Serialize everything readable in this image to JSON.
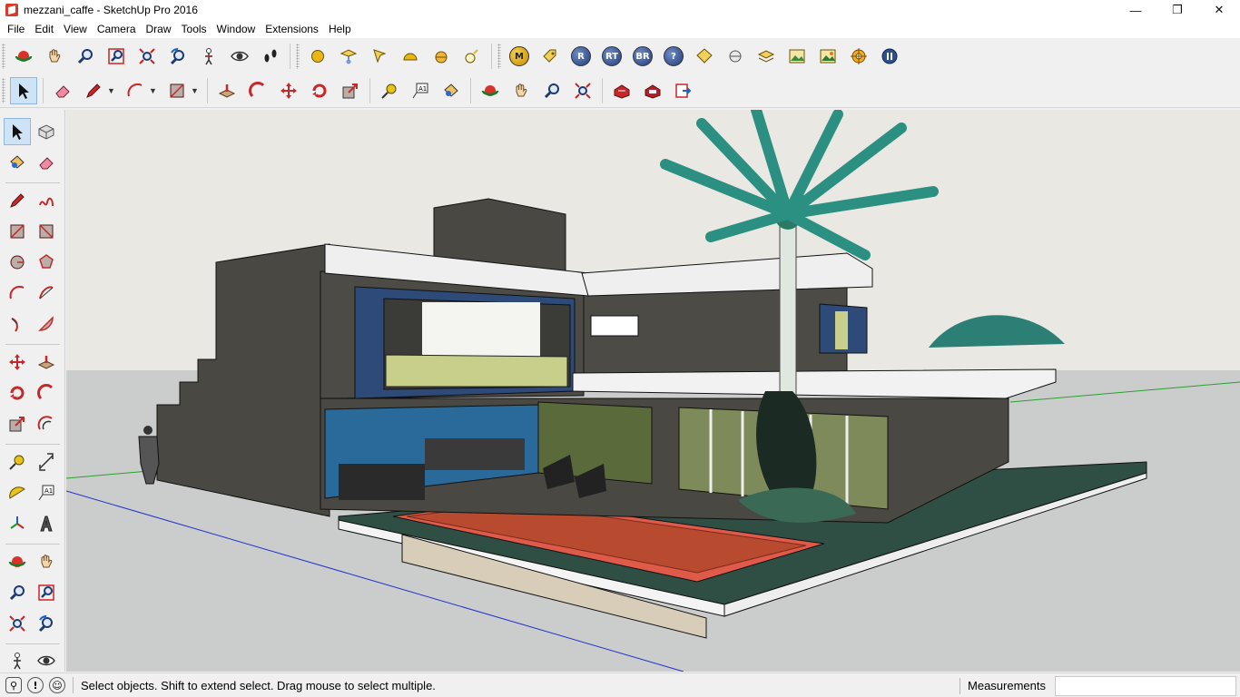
{
  "window": {
    "title": "mezzani_caffe - SketchUp Pro 2016"
  },
  "window_controls": {
    "minimize": "—",
    "maximize": "❐",
    "close": "✕"
  },
  "menu": [
    "File",
    "Edit",
    "View",
    "Camera",
    "Draw",
    "Tools",
    "Window",
    "Extensions",
    "Help"
  ],
  "plugin_toolbar": {
    "badges": [
      "M",
      "R",
      "RT",
      "BR",
      "?"
    ]
  },
  "toolbar2": {
    "text_tool_glyph": "A1"
  },
  "left_toolbar": {
    "text_tool_glyph": "A1"
  },
  "statusbar": {
    "message": "Select objects. Shift to extend select. Drag mouse to select multiple.",
    "measurements_label": "Measurements",
    "measurements_value": "",
    "info_glyph": "!"
  },
  "colors": {
    "accent_selected": "#cfe3f6",
    "sky": "#eae8e3",
    "ground": "#cbcdcc",
    "house": "#4a4843"
  }
}
